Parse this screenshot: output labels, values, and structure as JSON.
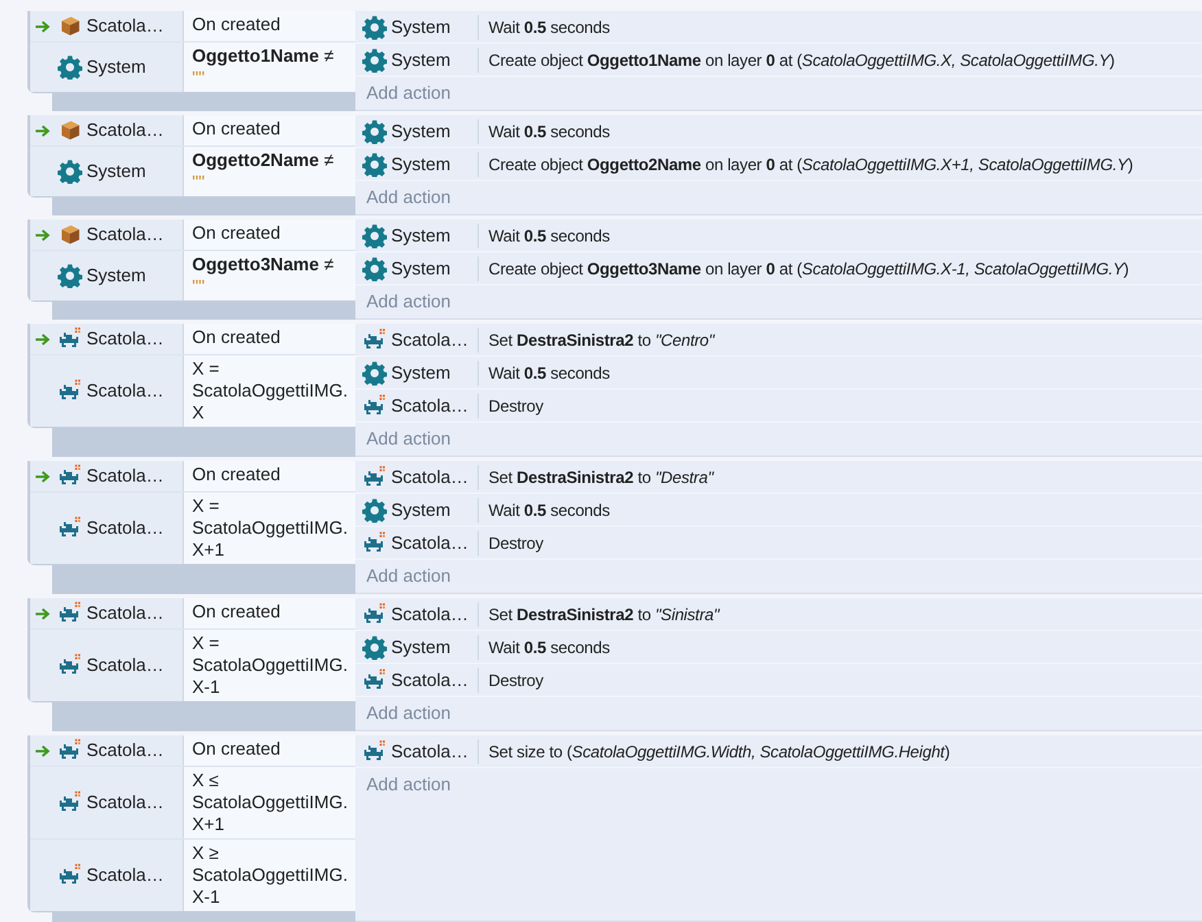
{
  "events": [
    {
      "conditions": [
        {
          "kind": "box",
          "object": "Scatola…",
          "text": "On created",
          "trigger": true
        },
        {
          "kind": "gear",
          "object": "System",
          "text": "**Oggetto1Name** ≠",
          "literal": "\"\"",
          "trigger": false
        }
      ],
      "actions": [
        {
          "kind": "gear",
          "object": "System",
          "text": "Wait **0.5** seconds"
        },
        {
          "kind": "gear",
          "object": "System",
          "text": "Create object **Oggetto1Name** on layer **0** at (*ScatolaOggettiIMG.X, ScatolaOggettiIMG.Y*)"
        }
      ],
      "add_action": "Add action"
    },
    {
      "conditions": [
        {
          "kind": "box",
          "object": "Scatola…",
          "text": "On created",
          "trigger": true
        },
        {
          "kind": "gear",
          "object": "System",
          "text": "**Oggetto2Name** ≠",
          "literal": "\"\"",
          "trigger": false
        }
      ],
      "actions": [
        {
          "kind": "gear",
          "object": "System",
          "text": "Wait **0.5** seconds"
        },
        {
          "kind": "gear",
          "object": "System",
          "text": "Create object **Oggetto2Name** on layer **0** at (*ScatolaOggettiIMG.X+1, ScatolaOggettiIMG.Y*)"
        }
      ],
      "add_action": "Add action"
    },
    {
      "conditions": [
        {
          "kind": "box",
          "object": "Scatola…",
          "text": "On created",
          "trigger": true
        },
        {
          "kind": "gear",
          "object": "System",
          "text": "**Oggetto3Name** ≠",
          "literal": "\"\"",
          "trigger": false
        }
      ],
      "actions": [
        {
          "kind": "gear",
          "object": "System",
          "text": "Wait **0.5** seconds"
        },
        {
          "kind": "gear",
          "object": "System",
          "text": "Create object **Oggetto3Name** on layer **0** at (*ScatolaOggettiIMG.X-1, ScatolaOggettiIMG.Y*)"
        }
      ],
      "add_action": "Add action"
    },
    {
      "conditions": [
        {
          "kind": "invader",
          "object": "Scatola…",
          "text": "On created",
          "trigger": true
        },
        {
          "kind": "invader",
          "object": "Scatola…",
          "text": "X = ScatolaOggettiIMG.X",
          "trigger": false
        }
      ],
      "actions": [
        {
          "kind": "invader",
          "object": "Scatola…",
          "text": "Set **DestraSinistra2** to *\"Centro\"*"
        },
        {
          "kind": "gear",
          "object": "System",
          "text": "Wait **0.5** seconds"
        },
        {
          "kind": "invader",
          "object": "Scatola…",
          "text": "Destroy"
        }
      ],
      "add_action": "Add action"
    },
    {
      "conditions": [
        {
          "kind": "invader",
          "object": "Scatola…",
          "text": "On created",
          "trigger": true
        },
        {
          "kind": "invader",
          "object": "Scatola…",
          "text": "X = ScatolaOggettiIMG.X+1",
          "trigger": false
        }
      ],
      "actions": [
        {
          "kind": "invader",
          "object": "Scatola…",
          "text": "Set **DestraSinistra2** to *\"Destra\"*"
        },
        {
          "kind": "gear",
          "object": "System",
          "text": "Wait **0.5** seconds"
        },
        {
          "kind": "invader",
          "object": "Scatola…",
          "text": "Destroy"
        }
      ],
      "add_action": "Add action"
    },
    {
      "conditions": [
        {
          "kind": "invader",
          "object": "Scatola…",
          "text": "On created",
          "trigger": true
        },
        {
          "kind": "invader",
          "object": "Scatola…",
          "text": "X = ScatolaOggettiIMG.X-1",
          "trigger": false
        }
      ],
      "actions": [
        {
          "kind": "invader",
          "object": "Scatola…",
          "text": "Set **DestraSinistra2** to *\"Sinistra\"*"
        },
        {
          "kind": "gear",
          "object": "System",
          "text": "Wait **0.5** seconds"
        },
        {
          "kind": "invader",
          "object": "Scatola…",
          "text": "Destroy"
        }
      ],
      "add_action": "Add action"
    },
    {
      "conditions": [
        {
          "kind": "invader",
          "object": "Scatola…",
          "text": "On created",
          "trigger": true
        },
        {
          "kind": "invader",
          "object": "Scatola…",
          "text": "X ≤ ScatolaOggettiIMG.X+1",
          "trigger": false
        },
        {
          "kind": "invader",
          "object": "Scatola…",
          "text": "X ≥ ScatolaOggettiIMG.X-1",
          "trigger": false
        }
      ],
      "actions": [
        {
          "kind": "invader",
          "object": "Scatola…",
          "text": "Set size to (*ScatolaOggettiIMG.Width, ScatolaOggettiIMG.Height*)"
        }
      ],
      "add_action": "Add action"
    }
  ]
}
